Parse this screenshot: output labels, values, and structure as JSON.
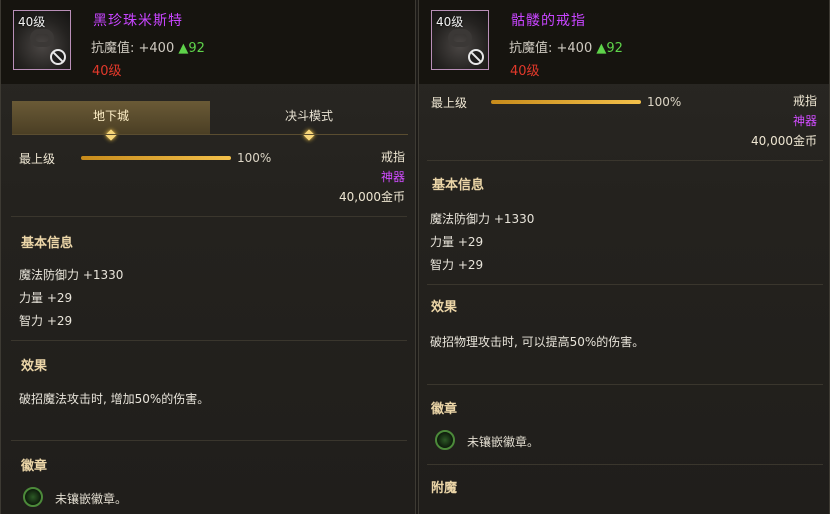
{
  "left": {
    "item": {
      "level_tag": "40级",
      "name": "黑珍珠米斯特",
      "stat_label": "抗魔值: +400",
      "stat_up": "▲92",
      "required_level": "40级"
    },
    "tabs": [
      {
        "label": "地下城",
        "active": true
      },
      {
        "label": "决斗模式",
        "active": false
      }
    ],
    "level_label": "最上级",
    "level_percent_text": "100%",
    "level_fraction": 1.0,
    "slot_type": "戒指",
    "rarity": "神器",
    "price": "40,000金币",
    "basic_info_title": "基本信息",
    "attributes": [
      "魔法防御力 +1330",
      "力量 +29",
      "智力 +29"
    ],
    "effect_title": "效果",
    "effect_text": "破招魔法攻击时, 增加50%的伤害。",
    "emblem_title": "徽章",
    "emblem_text": "未镶嵌徽章。"
  },
  "right": {
    "item": {
      "level_tag": "40级",
      "name": "骷髅的戒指",
      "stat_label": "抗魔值: +400",
      "stat_up": "▲92",
      "required_level": "40级"
    },
    "level_label": "最上级",
    "level_percent_text": "100%",
    "level_fraction": 1.0,
    "slot_type": "戒指",
    "rarity": "神器",
    "price": "40,000金币",
    "basic_info_title": "基本信息",
    "attributes": [
      "魔法防御力 +1330",
      "力量 +29",
      "智力 +29"
    ],
    "effect_title": "效果",
    "effect_text": "破招物理攻击时, 可以提高50%的伤害。",
    "emblem_title": "徽章",
    "emblem_text": "未镶嵌徽章。",
    "enchant_title": "附魔"
  },
  "colors": {
    "epic_name": "#c845ff",
    "stat_up": "#5ed34a",
    "required_level": "#e2392b",
    "section_title": "#ecd6a8",
    "bar_fill": "#f3c04a"
  }
}
